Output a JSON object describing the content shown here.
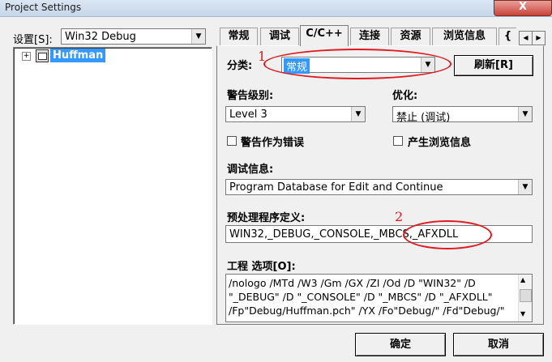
{
  "window": {
    "title": "Project Settings",
    "close_glyph": "X"
  },
  "settings_for": {
    "label": "设置[S]:",
    "value": "Win32 Debug"
  },
  "tree": {
    "expander": "+",
    "project_name": "Huffman"
  },
  "tabs": [
    {
      "label": "常规"
    },
    {
      "label": "调试"
    },
    {
      "label": "C/C++"
    },
    {
      "label": "连接"
    },
    {
      "label": "资源"
    },
    {
      "label": "浏览信息"
    },
    {
      "label": "{"
    }
  ],
  "tab_scroll": {
    "left": "◀",
    "right": "▶"
  },
  "category": {
    "label": "分类:",
    "value": "常规"
  },
  "refresh_button": "刷新[R]",
  "warning_level": {
    "label": "警告级别:",
    "value": "Level 3"
  },
  "optimization": {
    "label": "优化:",
    "value": "禁止 (调试)"
  },
  "warnings_as_errors": "警告作为错误",
  "generate_browse_info": "产生浏览信息",
  "debug_info": {
    "label": "调试信息:",
    "value": "Program Database for Edit and Continue"
  },
  "preprocessor": {
    "label": "预处理程序定义:",
    "value": "WIN32,_DEBUG,_CONSOLE,_MBCS,_AFXDLL"
  },
  "project_options": {
    "label": "工程 选项[O]:",
    "lines": [
      "/nologo /MTd /W3 /Gm /GX /ZI /Od /D \"WIN32\" /D",
      "\"_DEBUG\" /D \"_CONSOLE\" /D \"_MBCS\" /D \"_AFXDLL\"",
      "/Fp\"Debug/Huffman.pch\" /YX /Fo\"Debug/\" /Fd\"Debug/\""
    ]
  },
  "annotations": {
    "one": "1",
    "two": "2"
  },
  "ok_button": "确定",
  "cancel_button": "取消",
  "colors": {
    "annotation_red": "#e0191f",
    "selection_blue": "#3399ff"
  }
}
